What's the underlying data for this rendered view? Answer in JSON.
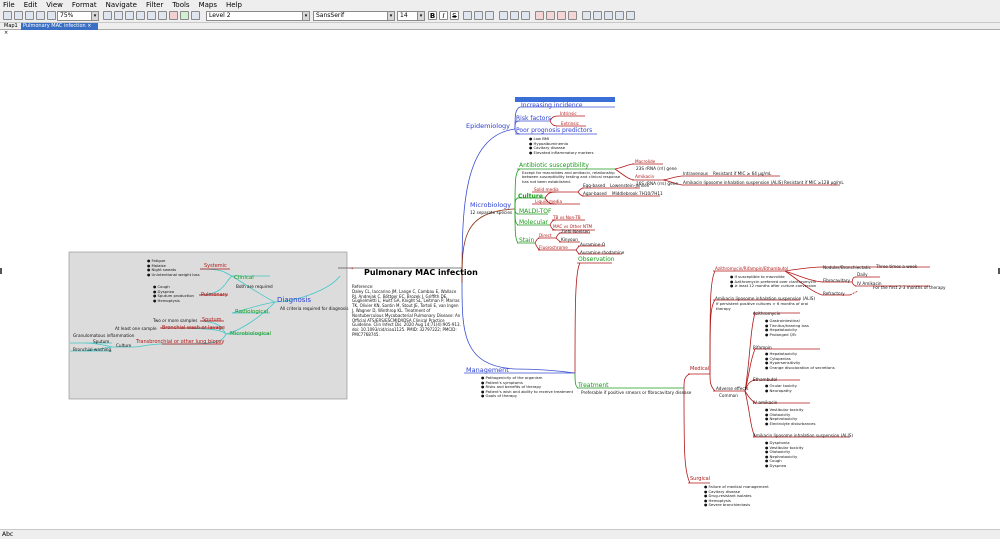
{
  "menu": [
    "File",
    "Edit",
    "View",
    "Format",
    "Navigate",
    "Filter",
    "Tools",
    "Maps",
    "Help"
  ],
  "toolbar": {
    "zoom": "75%",
    "style": "Level 2",
    "font": "SansSerif",
    "size": "14",
    "bold": "B",
    "italic": "I",
    "strike": "S"
  },
  "tabs": [
    "Map1 ×",
    "Pulmonary MAC infection ×"
  ],
  "status": "Abc",
  "colors": {
    "blue": "#2b3fd0",
    "green": "#1a9a1a",
    "red": "#b01818",
    "teal": "#40c8c8"
  },
  "map": {
    "root": "Pulmonary MAC infection",
    "reference": "Reference:\nDaley CL, Iaccarino JM, Lange C, Cambau E, Wallace\nRJ, Andrejak C, Böttger EC, Brozek J, Griffith DE,\nGuglielmetti L, Huitt GA, Knight SL, Leitman P, Marras\nTK, Olivier KN, Santin M, Stout JE, Tortoli E, van Ingen\nJ, Wagner D, Winthrop KL. Treatment of\nNontuberculous Mycobacterial Pulmonary Disease: An\nOfficial ATS/ERS/ESCMID/IDSA Clinical Practice\nGuideline. Clin Infect Dis. 2020 Aug 14;71(4):905-913.\ndoi: 10.1093/cid/ciaa1125. PMID: 32797222; PMCID:\nPMC7768745.",
    "epidemiology": {
      "label": "Epidemiology",
      "increasing": "Increasing incidence",
      "risk": "Risk factors",
      "intrinsic": "Intrinsic",
      "extrinsic": "Extrinsic",
      "poor": "Poor prognosis predictors",
      "poor_items": "● Low BMI\n● Hypoalbuminemia\n● Cavitary disease\n● Elevated inflammatory markers"
    },
    "microbiology": {
      "label": "Microbiology",
      "note": "12 separate species",
      "abx": "Antibiotic susceptibility",
      "abx_note": "Except for macrolides and amikacin, relationship\nbetween susceptibility testing and clinical response\nhas not been established.",
      "macrolide": "Macrolide",
      "macrolide_gene": "23S rRNA (rrl) gene",
      "amikacin": "Amikacin",
      "amikacin_gene": "16S rRNA (rrs) gene",
      "intravenous": "Intravenous",
      "iv_resist": "Resistant if MIC ≥ 64 μg/mL",
      "alis": "Amikacin liposome inhalation suspension (ALIS)",
      "alis_resist": "Resistant if MIC ≥128 μg/mL",
      "culture": "Culture",
      "solid": "Solid media",
      "egg": "Egg-based",
      "lj": "Lowenstein-Jensen",
      "agar": "Agar-based",
      "mb": "Middlebrook 7H10/7H11",
      "liquid": "Liquid media",
      "maldi": "MALDI-TOF",
      "molecular": "Molecular",
      "tbnon": "TB vs Non-TB",
      "macother": "MAC vs Other NTM",
      "stain": "Stain",
      "direct": "Direct",
      "zn": "Ziehl-Neelsen",
      "kinyoun": "Kinyoun",
      "fluoro": "Fluorochrome",
      "auramine": "Auramine-O",
      "aurrhod": "Auramine-rhodamine"
    },
    "diagnosis": {
      "label": "Diagnosis",
      "note": "All criteria required for diagnosis",
      "clinical": "Clinical",
      "both": "Both are required",
      "systemic": "Systemic",
      "systemic_items": "● Fatigue\n● Malaise\n● Night sweats\n● Unintentional weight loss",
      "pulmonary": "Pulmonary",
      "pulmonary_items": "● Cough\n● Dyspnea\n● Sputum production\n● Hemoptysis",
      "radiological": "Radiological",
      "microbiological": "Microbiological",
      "sputum": "Sputum",
      "two_more": "Two or more samples",
      "bronchial": "Bronchial wash or lavage",
      "atleast": "At least one sample",
      "transbronchial": "Transbronchial or other lung biopsy",
      "granulomatous": "Granulomatous inflammation",
      "sputum2": "Sputum",
      "culture": "Culture",
      "bwash": "Bronchial washing"
    },
    "management": {
      "label": "Management",
      "items": "● Pathogenicity of the organism\n● Patient's symptoms\n● Risks and benefits of therapy\n● Patient's wish and ability to receive treatment\n● Goals of therapy",
      "observation": "Observation",
      "treatment": "Treatment",
      "treatment_note": "Preferable if positive smears or fibrocavitary disease",
      "medical": "Medical",
      "regimen1": "Azithromycin/Rifampin/Ethambutol",
      "regimen1_items": "● If susceptible to macrolide\n● Azithromycin preferred over clarithromycin\n● ≥ least 12 months after culture conversion",
      "nodular": "Nodular/Bronchiectatic",
      "three_week": "Three times a week",
      "fibro": "Fibrocavitary",
      "daily": "Daily",
      "ivamik": "IV Amikacin",
      "first23": "For the first 2-3 months of therapy",
      "refractory": "Refractory",
      "alis_add": "Amikacin liposome inhalation suspension (ALIS)",
      "alis_add_note": "If persistent positive cultures > 6 months of oral\ntherapy",
      "adverse": "Adverse effects",
      "common": "Common",
      "azithro": "Azithromycin",
      "azithro_items": "● Gastrointestinal\n● Tinnitus/hearing loss\n● Hepatotoxicity\n● Prolonged QTc",
      "rifampin": "Rifampin",
      "rifampin_items": "● Hepatotoxicity\n● Cytopenias\n● Hypersensitivity\n● Orange discoloration of secretions",
      "ethambutol": "Ethambutol",
      "ethambutol_items": "● Ocular toxicity\n● Neuropathy",
      "ivamik2": "IV amikacin",
      "ivamik_items": "● Vestibular toxicity\n● Ototoxicity\n● Nephrotoxicity\n● Electrolyte disturbances",
      "alis2": "Amikacin liposome inhalation suspension (ALIS)",
      "alis2_items": "● Dysphonia\n● Vestibular toxicity\n● Ototoxicity\n● Nephrotoxicity\n● Cough\n● Dyspnea",
      "surgical": "Surgical",
      "surgical_items": "● Failure of medical management\n● Cavitary disease\n● Drug-resistant isolates\n● Hemoptysis\n● Severe bronchiectasis"
    }
  }
}
